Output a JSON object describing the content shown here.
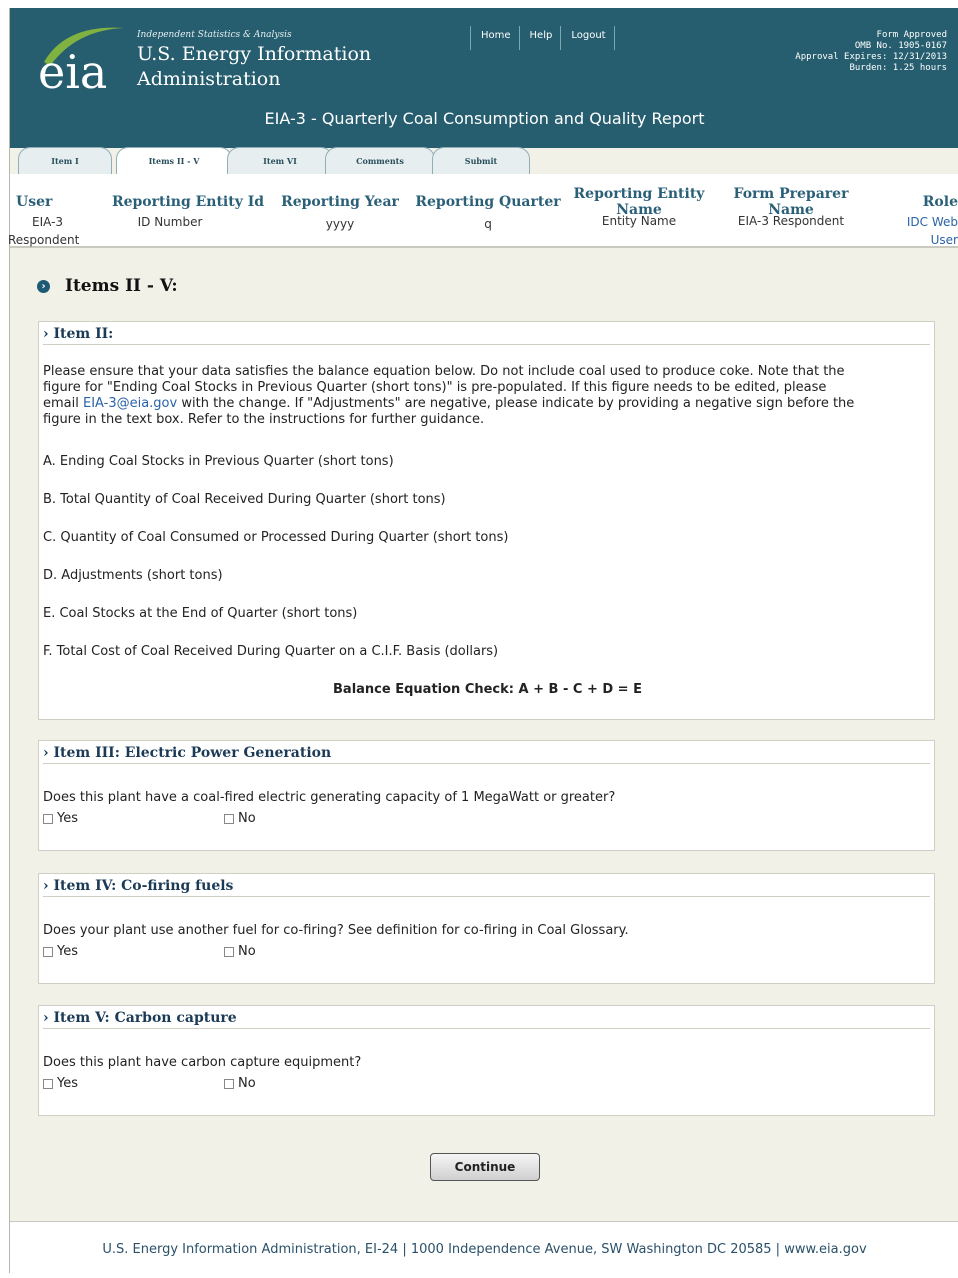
{
  "brand": {
    "tagline": "Independent Statistics & Analysis",
    "logo_text": "eia",
    "name_line1": "U.S. Energy Information",
    "name_line2": "Administration"
  },
  "topnav": [
    "Home",
    "Help",
    "Logout"
  ],
  "omb": {
    "line1": "Form Approved",
    "line2": "OMB No. 1905-0167",
    "line3": "Approval Expires: 12/31/2013",
    "line4": "Burden: 1.25 hours"
  },
  "form_title": "EIA-3 - Quarterly Coal Consumption and Quality Report",
  "tabs": [
    "Item I",
    "Items II - V",
    "Item VI",
    "Comments",
    "Submit"
  ],
  "info": {
    "user_h": "User",
    "user_v1": "EIA-3",
    "user_v2": "Respondent",
    "entity_id_h": "Reporting Entity Id",
    "entity_id_v": "ID Number",
    "year_h": "Reporting Year",
    "year_v": "yyyy",
    "quarter_h": "Reporting Quarter",
    "quarter_v": "q",
    "entity_name_h1": "Reporting Entity",
    "entity_name_h2": "Name",
    "entity_name_v": "Entity Name",
    "preparer_h1": "Form Preparer",
    "preparer_h2": "Name",
    "preparer_v": "EIA-3 Respondent",
    "role_h": "Role",
    "role_v1": "IDC Web",
    "role_v2": "User"
  },
  "section_title": "Items II - V:",
  "item2": {
    "title": "› Item II:",
    "intro1": "Please ensure that your data satisfies the balance equation below. Do not include coal used to produce coke. Note that the",
    "intro2": "figure for \"Ending Coal Stocks in Previous Quarter (short tons)\" is pre-populated. If this figure needs to be edited, please",
    "intro3a": "email ",
    "intro3_link": "EIA-3@eia.gov",
    "intro3b": " with the change. If \"Adjustments\" are negative, please indicate by providing a negative sign before the",
    "intro4": "figure in the text box. Refer to the instructions for further guidance.",
    "lines": [
      "A.  Ending Coal Stocks in Previous Quarter (short tons)",
      "B.  Total Quantity of Coal Received During Quarter (short tons)",
      "C.  Quantity of Coal Consumed or Processed During Quarter (short tons)",
      "D.  Adjustments (short tons)",
      "E.  Coal Stocks at the End of Quarter (short tons)",
      "F.  Total Cost of Coal Received During Quarter on a C.I.F. Basis (dollars)"
    ],
    "balance": "Balance Equation Check: A + B - C + D = E"
  },
  "item3": {
    "title": "› Item III: Electric Power Generation",
    "question": "Does this plant have a coal-fired electric generating capacity of 1 MegaWatt or greater?",
    "yes": "Yes",
    "no": "No"
  },
  "item4": {
    "title": "› Item IV: Co-firing fuels",
    "question": "Does your plant use another fuel for co-firing? See definition for co-firing in Coal Glossary.",
    "yes": "Yes",
    "no": "No"
  },
  "item5": {
    "title": "› Item V: Carbon capture",
    "question": "Does this plant have carbon capture equipment?",
    "yes": "Yes",
    "no": "No"
  },
  "continue_label": "Continue",
  "footer": "U.S. Energy Information Administration, EI-24 | 1000 Independence Avenue, SW Washington DC 20585  | www.eia.gov",
  "colors": {
    "header_bg": "#265e6f",
    "page_bg": "#f1f1e8",
    "heading_blue": "#2a5f78",
    "link_blue": "#2a63a8"
  }
}
